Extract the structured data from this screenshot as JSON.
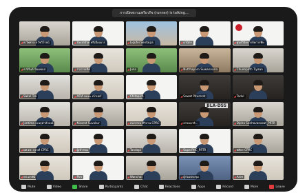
{
  "meeting": {
    "speaker_banner": "การเปิดสถานเพรียวกิจ (runner) is talking..."
  },
  "participants": [
    {
      "name": "ศ.ไพศาล ธวัชวิโรจน์"
    },
    {
      "name": "Yuxinthai ศรีเมืองมาร"
    },
    {
      "name": "Liqufei Sentaipa"
    },
    {
      "name": "ผานิตา"
    },
    {
      "name": "ศูนย์วิจัยการจัดการพิษ"
    },
    {
      "name": "ศ.นิรันต์ นิยมพลส"
    },
    {
      "name": "ราสวรรดิศ"
    },
    {
      "name": "Juna"
    },
    {
      "name": "Nutthaporn Suwannarin"
    },
    {
      "name": "Chuenpath Tiyaan"
    },
    {
      "name": "Sakul Tsa"
    },
    {
      "name": "AFIA มอมะ เจ้าปอร์"
    },
    {
      "name": "Chitapich"
    },
    {
      "name": "Sawat Pitumrat"
    },
    {
      "name": "Tadul"
    },
    {
      "name": "Jantima เจนจุฬาลักษณ์"
    },
    {
      "name": "Nisarat Suvokur"
    },
    {
      "name": "ธนวรรณ ดีวิจาน CPRC"
    },
    {
      "name": "ธรรมมาธิ..."
    },
    {
      "name": "Dipha Sonhavanasat_PRTR"
    },
    {
      "name": "ผศ.ดร. กุลวดี CPRC"
    },
    {
      "name": "ผู้เข้าร่วม"
    },
    {
      "name": "Tandapi"
    },
    {
      "name": "Supa PHC_PRTR"
    },
    {
      "name": "ศศิธร CPRC"
    },
    {
      "name": "ดร.มาลินี"
    },
    {
      "name": "Pim"
    },
    {
      "name": "Wanchai"
    },
    {
      "name": "ผู้ร่วมประชุม"
    },
    {
      "name": "Aree"
    }
  ],
  "bla_sign": "BLA-DSS",
  "toolbar": [
    {
      "label": "Mute",
      "icon": "mic-icon"
    },
    {
      "label": "Video",
      "icon": "camera-icon"
    },
    {
      "label": "Share",
      "icon": "share-icon"
    },
    {
      "label": "Participants",
      "icon": "people-icon"
    },
    {
      "label": "Chat",
      "icon": "chat-icon"
    },
    {
      "label": "Reactions",
      "icon": "reaction-icon"
    },
    {
      "label": "Apps",
      "icon": "apps-icon"
    },
    {
      "label": "Record",
      "icon": "record-icon"
    },
    {
      "label": "More",
      "icon": "more-icon"
    },
    {
      "label": "Leave",
      "icon": "leave-icon"
    }
  ]
}
